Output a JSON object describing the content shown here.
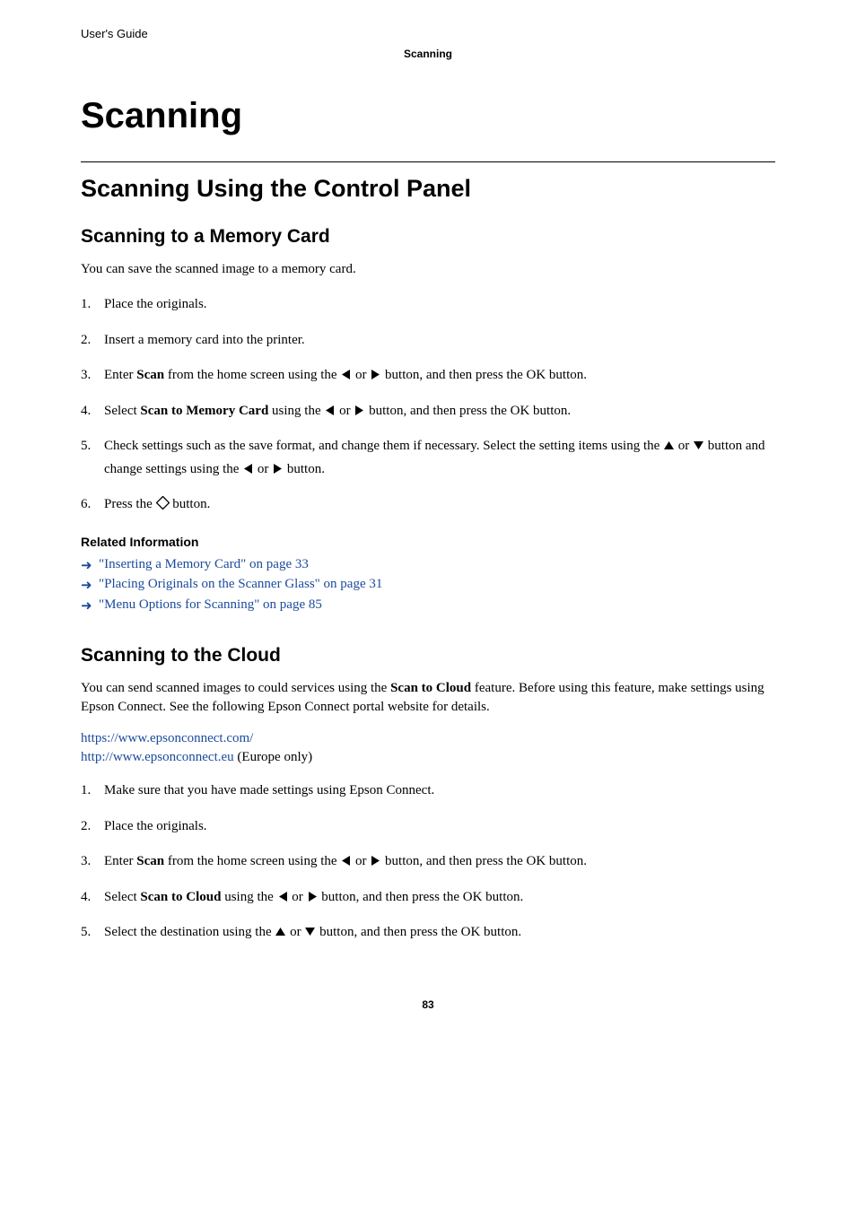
{
  "header": {
    "doc_type": "User's Guide"
  },
  "breadcrumb": "Scanning",
  "chapter_title": "Scanning",
  "section_title": "Scanning Using the Control Panel",
  "sub1": {
    "title": "Scanning to a Memory Card",
    "intro": "You can save the scanned image to a memory card.",
    "steps": {
      "s1": "Place the originals.",
      "s2": "Insert a memory card into the printer.",
      "s3a": "Enter ",
      "s3b": "Scan",
      "s3c": " from the home screen using the ",
      "s3d": " or ",
      "s3e": " button, and then press the OK button.",
      "s4a": "Select ",
      "s4b": "Scan to Memory Card",
      "s4c": " using the ",
      "s4d": " or ",
      "s4e": " button, and then press the OK button.",
      "s5a": "Check settings such as the save format, and change them if necessary. Select the setting items using the ",
      "s5b": " or ",
      "s5c": " button and change settings using the ",
      "s5d": " or ",
      "s5e": " button.",
      "s6a": "Press the ",
      "s6b": " button."
    },
    "related_title": "Related Information",
    "related": {
      "r1": "\"Inserting a Memory Card\" on page 33",
      "r2": "\"Placing Originals on the Scanner Glass\" on page 31",
      "r3": "\"Menu Options for Scanning\" on page 85"
    }
  },
  "sub2": {
    "title": "Scanning to the Cloud",
    "intro_a": "You can send scanned images to could services using the ",
    "intro_b": "Scan to Cloud",
    "intro_c": " feature. Before using this feature, make settings using Epson Connect. See the following Epson Connect portal website for details.",
    "url1": "https://www.epsonconnect.com/",
    "url2": "http://www.epsonconnect.eu",
    "eu_note": " (Europe only)",
    "steps": {
      "s1": "Make sure that you have made settings using Epson Connect.",
      "s2": "Place the originals.",
      "s3a": "Enter ",
      "s3b": "Scan",
      "s3c": " from the home screen using the ",
      "s3d": " or ",
      "s3e": " button, and then press the OK button.",
      "s4a": "Select ",
      "s4b": "Scan to Cloud",
      "s4c": " using the ",
      "s4d": " or ",
      "s4e": " button, and then press the OK button.",
      "s5a": "Select the destination using the ",
      "s5b": " or ",
      "s5c": " button, and then press the OK button."
    }
  },
  "page_number": "83"
}
